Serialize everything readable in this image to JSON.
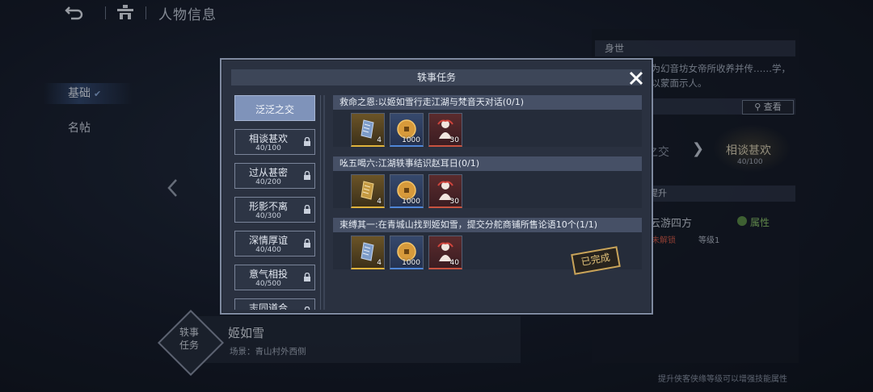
{
  "topbar": {
    "title": "人物信息"
  },
  "sidebar": {
    "items": [
      {
        "label": "基础",
        "active": true
      },
      {
        "label": "名帖",
        "active": false
      }
    ]
  },
  "right_panel": {
    "section1_title": "身世",
    "bio": "……幼女，为幻音坊女帝所收养并传……学，外出行事多以蒙面示人。",
    "view_button": "查看",
    "relation_from": "泛泛之交",
    "relation_to": "相谈甚欢",
    "relation_to_progress": "40/100",
    "section3_title": "……甚欢可提升",
    "skill_name": "云游四方",
    "skill_status": "未解锁",
    "skill_level": "等级1",
    "attr_label": "属性",
    "footer_note": "提升侠客侠缘等级可以增强技能属性"
  },
  "npc": {
    "badge_line1": "轶事",
    "badge_line2": "任务",
    "name": "姬如雪",
    "scene": "场景：青山村外西侧"
  },
  "modal": {
    "title": "轶事任务",
    "relations": [
      {
        "name": "泛泛之交",
        "count": "",
        "active": true
      },
      {
        "name": "相谈甚欢",
        "count": "40/100",
        "active": false
      },
      {
        "name": "过从甚密",
        "count": "40/200",
        "active": false
      },
      {
        "name": "形影不离",
        "count": "40/300",
        "active": false
      },
      {
        "name": "深情厚谊",
        "count": "40/400",
        "active": false
      },
      {
        "name": "意气相投",
        "count": "40/500",
        "active": false
      },
      {
        "name": "志同道合",
        "count": "",
        "active": false
      }
    ],
    "tasks": [
      {
        "title": "救命之恩:以姬如雪行走江湖与梵音天对话(0/1)",
        "rewards": [
          {
            "kind": "scroll-silver",
            "rarity": "gold",
            "qty": "4"
          },
          {
            "kind": "coin",
            "rarity": "blue",
            "qty": "1000"
          },
          {
            "kind": "figure",
            "rarity": "red",
            "qty": "30"
          }
        ],
        "completed": false
      },
      {
        "title": "吆五喝六:江湖轶事结识赵耳日(0/1)",
        "rewards": [
          {
            "kind": "scroll-gold",
            "rarity": "gold",
            "qty": "4"
          },
          {
            "kind": "coin",
            "rarity": "blue",
            "qty": "1000"
          },
          {
            "kind": "figure",
            "rarity": "red",
            "qty": "30"
          }
        ],
        "completed": false
      },
      {
        "title": "束缚其一:在青城山找到姬如雪，提交分舵商铺所售论语10个(1/1)",
        "rewards": [
          {
            "kind": "scroll-silver",
            "rarity": "gold",
            "qty": "4"
          },
          {
            "kind": "coin",
            "rarity": "blue",
            "qty": "1000"
          },
          {
            "kind": "figure",
            "rarity": "red",
            "qty": "40"
          }
        ],
        "completed": true
      }
    ],
    "completed_stamp": "已完成"
  },
  "colors": {
    "accent": "#7f93ba",
    "completed": "#e3c37a",
    "locked": "#d55a46",
    "attribute": "#8fc96a"
  }
}
